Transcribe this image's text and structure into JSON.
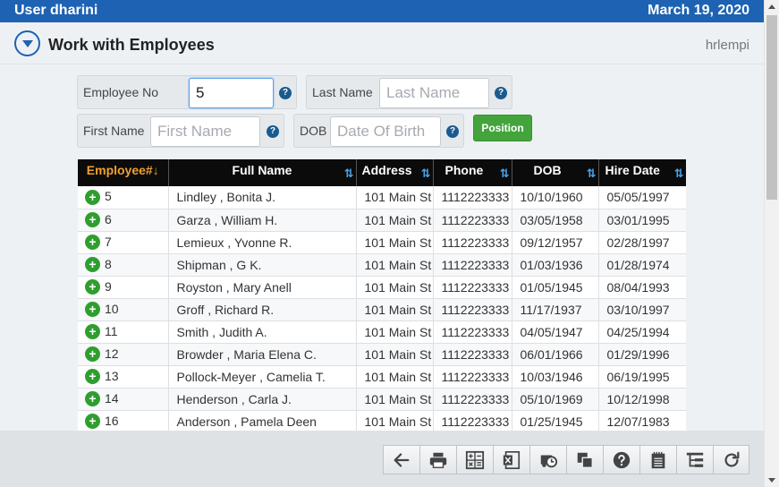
{
  "topbar": {
    "user": "User dharini",
    "date": "March 19, 2020"
  },
  "header": {
    "title": "Work with Employees",
    "program": "hrlempi"
  },
  "filters": {
    "employee_no": {
      "label": "Employee No",
      "value": "5",
      "placeholder": ""
    },
    "last_name": {
      "label": "Last Name",
      "value": "",
      "placeholder": "Last Name"
    },
    "first_name": {
      "label": "First Name",
      "value": "",
      "placeholder": "First Name"
    },
    "dob": {
      "label": "DOB",
      "value": "",
      "placeholder": "Date Of Birth"
    },
    "help_glyph": "?",
    "position_label": "Position"
  },
  "grid": {
    "columns": [
      "Employee#",
      "Full Name",
      "Address",
      "Phone",
      "DOB",
      "Hire Date"
    ],
    "sort_icon": "⇅",
    "active_sort_arrow": "↓",
    "plus_glyph": "+",
    "rows": [
      [
        "5",
        "Lindley , Bonita J.",
        "101 Main St",
        "1112223333",
        "10/10/1960",
        "05/05/1997"
      ],
      [
        "6",
        "Garza , William H.",
        "101 Main St",
        "1112223333",
        "03/05/1958",
        "03/01/1995"
      ],
      [
        "7",
        "Lemieux , Yvonne R.",
        "101 Main St",
        "1112223333",
        "09/12/1957",
        "02/28/1997"
      ],
      [
        "8",
        "Shipman , G K.",
        "101 Main St",
        "1112223333",
        "01/03/1936",
        "01/28/1974"
      ],
      [
        "9",
        "Royston , Mary Anell",
        "101 Main St",
        "1112223333",
        "01/05/1945",
        "08/04/1993"
      ],
      [
        "10",
        "Groff , Richard R.",
        "101 Main St",
        "1112223333",
        "11/17/1937",
        "03/10/1997"
      ],
      [
        "11",
        "Smith , Judith A.",
        "101 Main St",
        "1112223333",
        "04/05/1947",
        "04/25/1994"
      ],
      [
        "12",
        "Browder , Maria Elena C.",
        "101 Main St",
        "1112223333",
        "06/01/1966",
        "01/29/1996"
      ],
      [
        "13",
        "Pollock-Meyer , Camelia T.",
        "101 Main St",
        "1112223333",
        "10/03/1946",
        "06/19/1995"
      ],
      [
        "14",
        "Henderson , Carla J.",
        "101 Main St",
        "1112223333",
        "05/10/1969",
        "10/12/1998"
      ],
      [
        "16",
        "Anderson , Pamela Deen",
        "101 Main St",
        "1112223333",
        "01/25/1945",
        "12/07/1983"
      ]
    ]
  },
  "toolbar": {
    "buttons": [
      "back-icon",
      "print-icon",
      "calculator-icon",
      "excel-icon",
      "schedule-icon",
      "copy-icon",
      "help-icon",
      "notepad-icon",
      "hierarchy-icon",
      "refresh-icon"
    ]
  },
  "colors": {
    "brand": "#1d62b3",
    "accent_green": "#43a43c",
    "sort_active": "#f0a030",
    "sort_icon": "#4aa6ee"
  }
}
